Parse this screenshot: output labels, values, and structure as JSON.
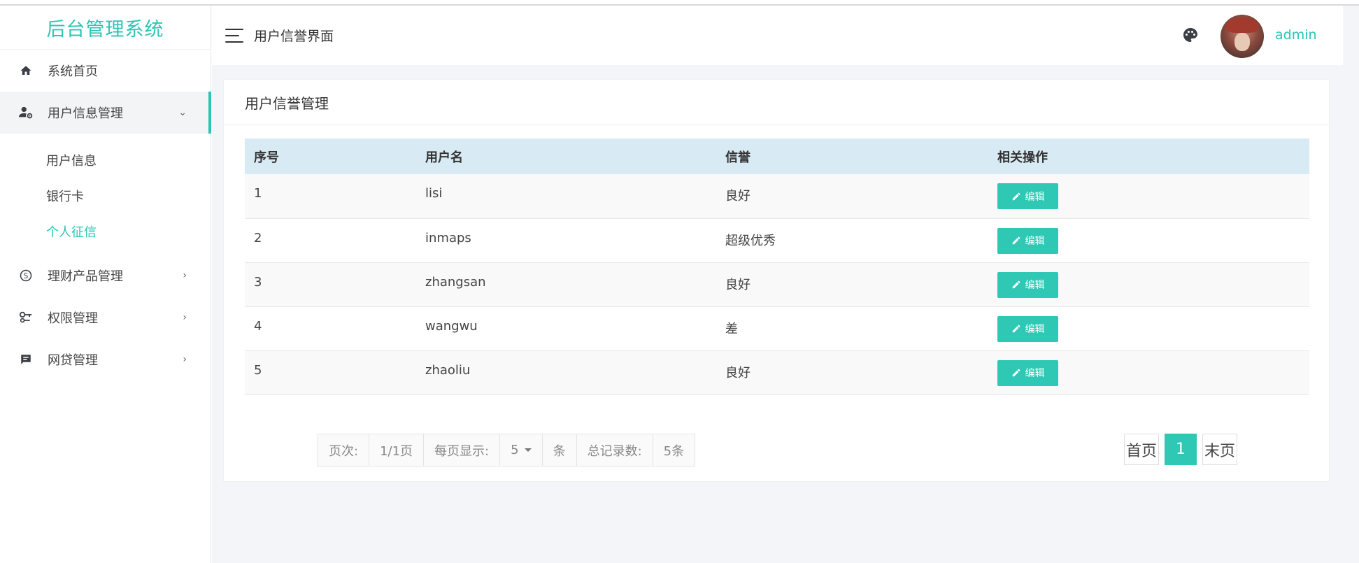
{
  "brand": "后台管理系统",
  "header": {
    "title": "用户信誉界面",
    "user": "admin"
  },
  "sidebar": {
    "items": [
      {
        "label": "系统首页",
        "icon": "home-icon"
      },
      {
        "label": "用户信息管理",
        "icon": "user-settings-icon",
        "expanded": true,
        "children": [
          "用户信息",
          "银行卡",
          "个人征信"
        ],
        "current_child": "个人征信"
      },
      {
        "label": "理财产品管理",
        "icon": "finance-icon"
      },
      {
        "label": "权限管理",
        "icon": "key-icon"
      },
      {
        "label": "网贷管理",
        "icon": "message-icon"
      }
    ]
  },
  "panel": {
    "title": "用户信誉管理"
  },
  "table": {
    "headers": [
      "序号",
      "用户名",
      "信誉",
      "相关操作"
    ],
    "rows": [
      {
        "id": "1",
        "username": "lisi",
        "credit": "良好",
        "action": "编辑"
      },
      {
        "id": "2",
        "username": "inmaps",
        "credit": "超级优秀",
        "action": "编辑"
      },
      {
        "id": "3",
        "username": "zhangsan",
        "credit": "良好",
        "action": "编辑"
      },
      {
        "id": "4",
        "username": "wangwu",
        "credit": "差",
        "action": "编辑"
      },
      {
        "id": "5",
        "username": "zhaoliu",
        "credit": "良好",
        "action": "编辑"
      }
    ]
  },
  "pagination": {
    "page_label": "页次:",
    "page_value": "1/1页",
    "per_page_label": "每页显示:",
    "per_page_value": "5",
    "unit": "条",
    "total_label": "总记录数:",
    "total_value": "5条",
    "first": "首页",
    "current": "1",
    "last": "末页"
  },
  "colors": {
    "accent": "#2cc5b4",
    "table_header": "#d8eaf4",
    "content_bg": "#f3f5f8"
  }
}
